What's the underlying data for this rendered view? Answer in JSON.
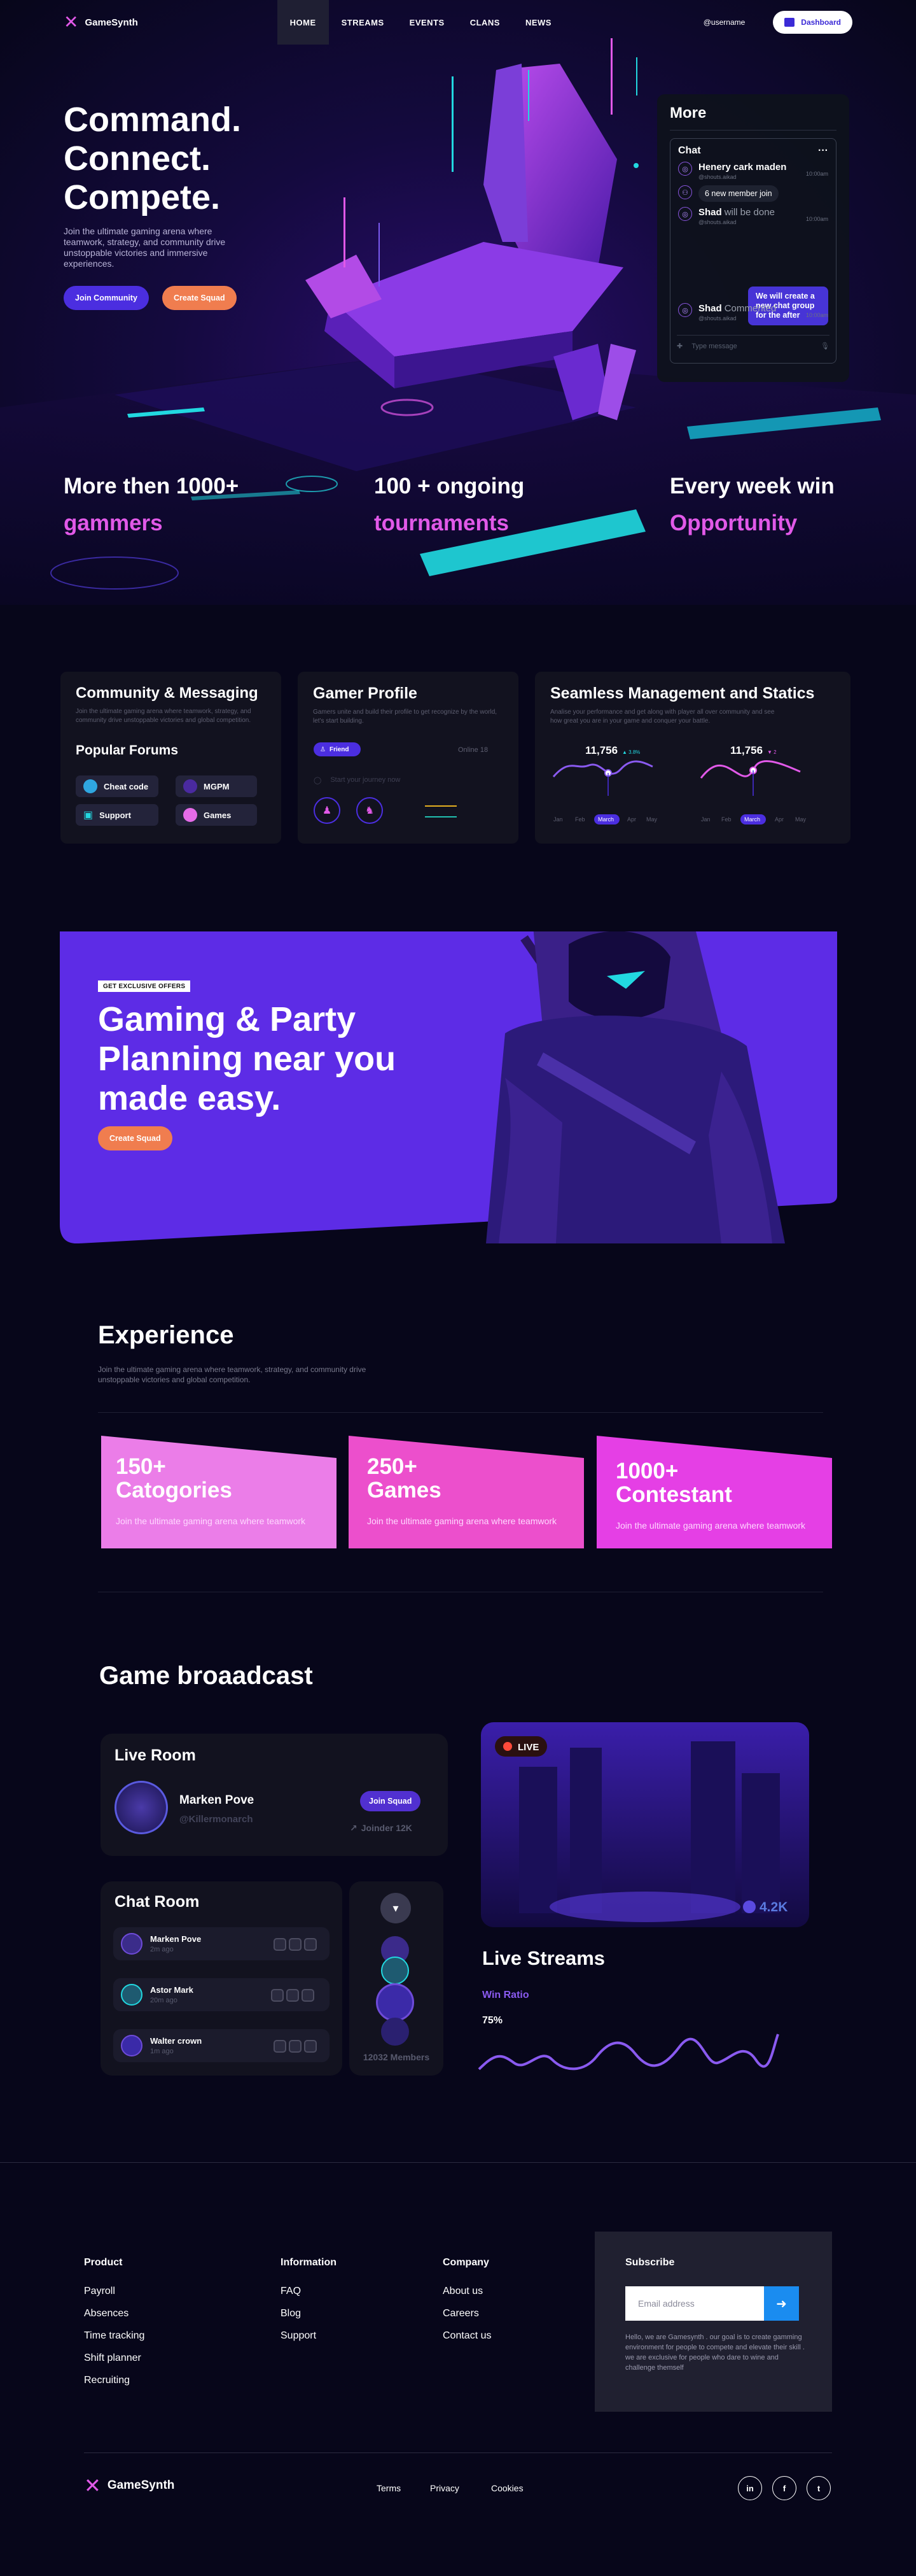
{
  "nav": {
    "logo": "GameSynth",
    "items": [
      "HOME",
      "STREAMS",
      "EVENTS",
      "CLANS",
      "NEWS"
    ],
    "username": "@username",
    "dashboard": "Dashboard"
  },
  "hero": {
    "headline": [
      "Command.",
      "Connect.",
      "Compete."
    ],
    "subtitle": "Join the ultimate gaming arena where teamwork, strategy, and community drive unstoppable victories and immersive experiences.",
    "join_btn": "Join Community",
    "squad_btn": "Create Squad",
    "stats": [
      {
        "a": "More then 1000+",
        "b": "gammers"
      },
      {
        "a": "100 + ongoing",
        "b": "tournaments"
      },
      {
        "a": "Every week win",
        "b": "Opportunity"
      }
    ]
  },
  "more_panel": {
    "title": "More",
    "chat_title": "Chat",
    "menu": "···",
    "messages": [
      {
        "who": "Henery cark maden",
        "handle": "@shouts.aikad",
        "time": "10:00am"
      },
      {
        "system": "6 new member join"
      },
      {
        "who": "Shad",
        "msg": "will be done",
        "handle": "@shouts.aikad",
        "time": "10:00am"
      },
      {
        "who": "Shad",
        "msg": "Commented",
        "handle": "@shouts.aikad",
        "time": "10:00am"
      }
    ],
    "bubble": "We will create a new chat group for the after",
    "input_placeholder": "Type message"
  },
  "features": [
    {
      "title": "Community & Messaging",
      "desc": "Join the ultimate gaming arena where teamwork, strategy, and community drive unstoppable victories and global competition.",
      "sub": "Popular Forums",
      "chips": [
        "Cheat code",
        "MGPM",
        "Support",
        "Games"
      ]
    },
    {
      "title": "Gamer Profile",
      "desc": "Gamers unite and build their profile to get recognize by the world, let's start building.",
      "badge": "Friend",
      "online": "Online 18",
      "input": "Start your journey now"
    },
    {
      "title": "Seamless Management and Statics",
      "desc": "Analise your performance and get along with player all over community and see how great you are in your game and conquer your battle.",
      "charts": [
        {
          "value": "11,756",
          "delta": "▲ 3.8%",
          "months": [
            "Jan",
            "Feb",
            "March",
            "Apr",
            "May"
          ]
        },
        {
          "value": "11,756",
          "delta": "▼ 2",
          "months": [
            "Jan",
            "Feb",
            "March",
            "Apr",
            "May"
          ]
        }
      ]
    }
  ],
  "banner": {
    "tag": "GET EXCLUSIVE OFFERS",
    "headline": "Gaming & Party Planning near you made easy.",
    "btn": "Create Squad"
  },
  "experience": {
    "title": "Experience",
    "desc": "Join the ultimate gaming arena where teamwork, strategy, and community drive unstoppable victories and global competition.",
    "stats": [
      {
        "n": "150+",
        "l": "Catogories",
        "d": "Join the ultimate gaming arena where teamwork",
        "color": "#eb7de8"
      },
      {
        "n": "250+",
        "l": "Games",
        "d": "Join the ultimate gaming arena where teamwork",
        "color": "#ec4fcc"
      },
      {
        "n": "1000+",
        "l": "Contestant",
        "d": "Join the ultimate gaming arena where teamwork",
        "color": "#e53fe5"
      }
    ]
  },
  "broadcast": {
    "title": "Game broaadcast",
    "live_room": {
      "title": "Live Room",
      "name": "Marken Pove",
      "handle": "@Killermonarch",
      "btn": "Join Squad",
      "joined": "Joinder 12K"
    },
    "chat_room": {
      "title": "Chat Room",
      "rows": [
        {
          "name": "Marken Pove",
          "time": "2m ago"
        },
        {
          "name": "Astor Mark",
          "time": "20m ago"
        },
        {
          "name": "Walter crown",
          "time": "1m ago"
        }
      ]
    },
    "members": "12032 Members",
    "live_badge": "LIVE",
    "viewers": "4.2K",
    "streams_title": "Live Streams",
    "win_ratio": "Win Ratio",
    "win_value": "75%"
  },
  "footer": {
    "columns": [
      {
        "head": "Product",
        "links": [
          "Payroll",
          "Absences",
          "Time tracking",
          "Shift planner",
          "Recruiting"
        ]
      },
      {
        "head": "Information",
        "links": [
          "FAQ",
          "Blog",
          "Support"
        ]
      },
      {
        "head": "Company",
        "links": [
          "About us",
          "Careers",
          "Contact us"
        ]
      }
    ],
    "subscribe": {
      "title": "Subscribe",
      "placeholder": "Email address",
      "text": "Hello, we are Gamesynth . our goal is to create gamming environment for people to compete and elevate their skill . we are exclusive for people who dare to wine and challenge themself"
    },
    "logo": "GameSynth",
    "links": [
      "Terms",
      "Privacy",
      "Cookies"
    ],
    "social": [
      "in",
      "f",
      "t"
    ]
  },
  "colors": {
    "accent": "#e159e8",
    "primary": "#4b2ee0",
    "orange": "#f07d4f",
    "bg": "#07061a",
    "card": "#12121f"
  }
}
